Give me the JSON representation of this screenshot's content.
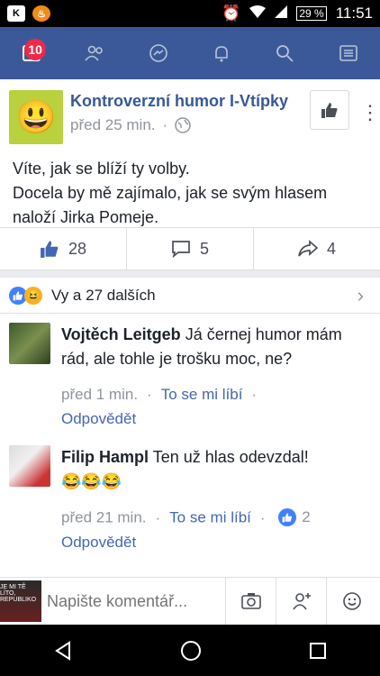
{
  "status_bar": {
    "battery": "29 %",
    "time": "11:51"
  },
  "nav": {
    "badge_count": "10"
  },
  "post": {
    "page_name": "Kontroverzní humor I-Vtípky",
    "time": "před 25 min.",
    "dot": "·",
    "text_line1": "Víte, jak se blíží ty volby.",
    "text_line2": "Docela by mě zajímalo, jak se svým hlasem naloží Jirka Pomeje."
  },
  "actions": {
    "likes": "28",
    "comments": "5",
    "shares": "4"
  },
  "reactions": {
    "summary": "Vy a 27 dalších"
  },
  "comments": [
    {
      "author": "Vojtěch Leitgeb",
      "text": " Já černej humor mám rád, ale tohle je trošku moc, ne?",
      "time": "před 1 min.",
      "like_label": "To se mi líbí",
      "reply_label": "Odpovědět"
    },
    {
      "author": "Filip Hampl",
      "text": " Ten už hlas odevzdal!",
      "emojis": "😂😂😂",
      "time": "před 21 min.",
      "like_label": "To se mi líbí",
      "like_count": "2",
      "reply_label": "Odpovědět"
    }
  ],
  "composer": {
    "placeholder": "Napište komentář...",
    "thumb_text": "JE MI TĚ LÍTO, REPUBLIKO"
  },
  "colors": {
    "brand": "#3b5998",
    "link": "#4267b2",
    "badge": "#f02849"
  }
}
